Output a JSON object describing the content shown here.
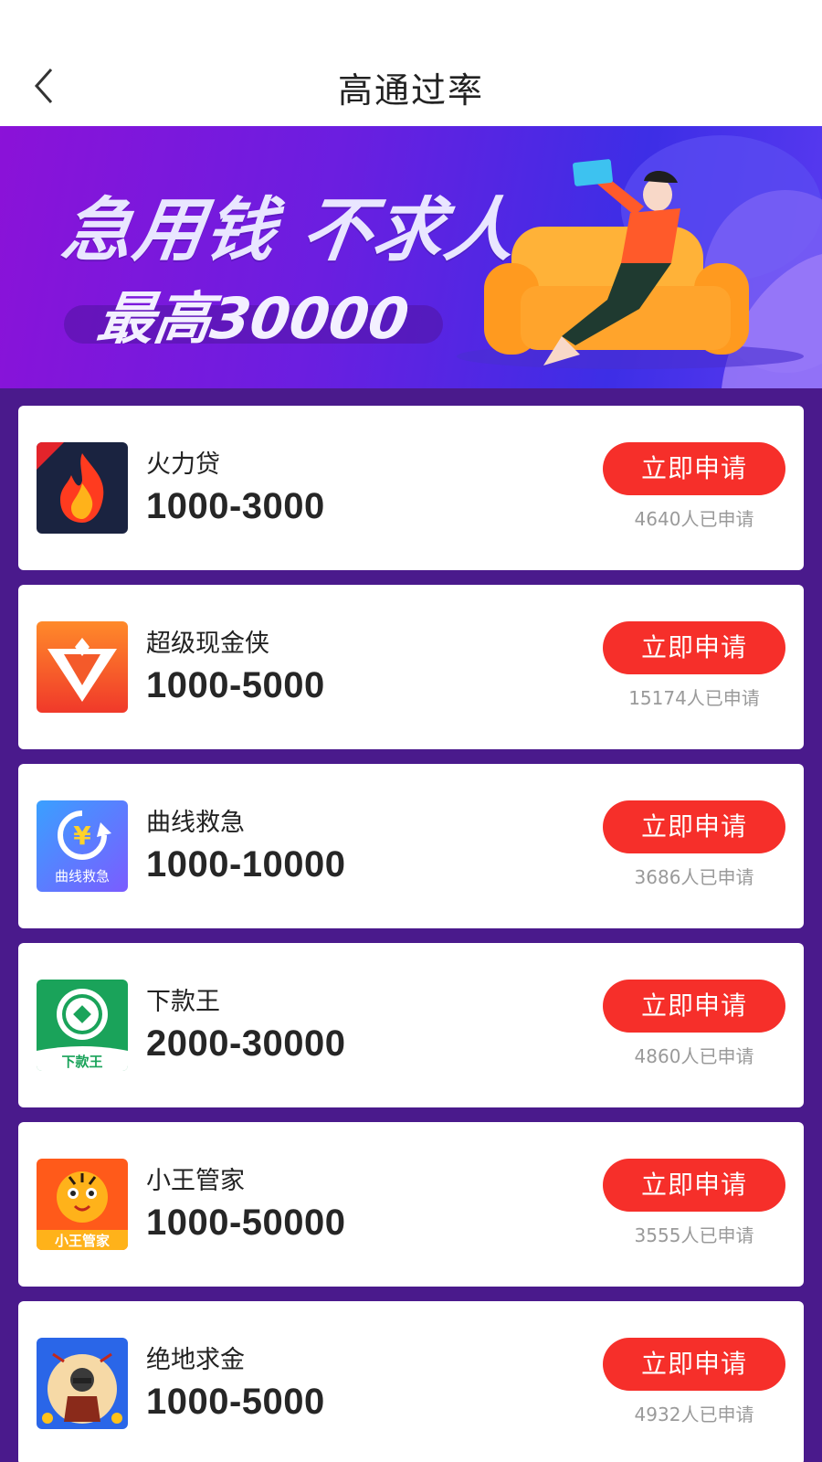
{
  "header": {
    "title": "高通过率",
    "back_icon": "chevron-left-icon"
  },
  "banner": {
    "headline": "急用钱 不求人",
    "subline": "最高30000"
  },
  "colors": {
    "accent": "#f62f2a",
    "background": "#4a1a8c",
    "card": "#ffffff"
  },
  "apply_label": "立即申请",
  "products": [
    {
      "name": "火力贷",
      "range": "1000-3000",
      "applicants": "4640人已申请",
      "icon": "flame-icon"
    },
    {
      "name": "超级现金侠",
      "range": "1000-5000",
      "applicants": "15174人已申请",
      "icon": "shield-v-icon"
    },
    {
      "name": "曲线救急",
      "range": "1000-10000",
      "applicants": "3686人已申请",
      "icon": "yuan-cycle-icon",
      "icon_text": "曲线救急"
    },
    {
      "name": "下款王",
      "range": "2000-30000",
      "applicants": "4860人已申请",
      "icon": "coin-icon",
      "icon_text": "下款王"
    },
    {
      "name": "小王管家",
      "range": "1000-50000",
      "applicants": "3555人已申请",
      "icon": "tiger-icon",
      "icon_text": "小王管家"
    },
    {
      "name": "绝地求金",
      "range": "1000-5000",
      "applicants": "4932人已申请",
      "icon": "soldier-icon"
    }
  ]
}
